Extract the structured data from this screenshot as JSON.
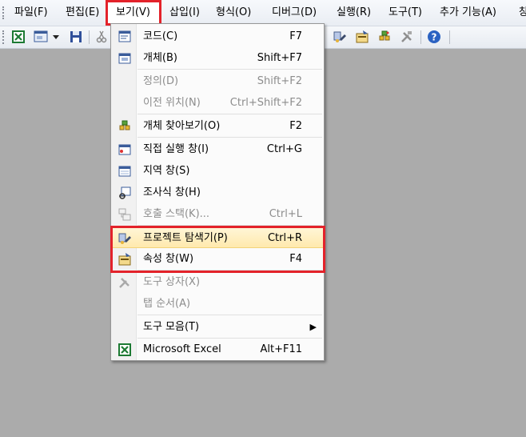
{
  "menubar": {
    "items": [
      {
        "label": "파일(F)"
      },
      {
        "label": "편집(E)"
      },
      {
        "label": "보기(V)"
      },
      {
        "label": "삽입(I)"
      },
      {
        "label": "형식(O)"
      },
      {
        "label": "디버그(D)"
      },
      {
        "label": "실행(R)"
      },
      {
        "label": "도구(T)"
      },
      {
        "label": "추가 기능(A)"
      },
      {
        "label": "창"
      }
    ]
  },
  "view_menu": {
    "items": [
      {
        "label": "코드(C)",
        "shortcut": "F7",
        "enabled": true,
        "icon": "code-window-icon"
      },
      {
        "label": "개체(B)",
        "shortcut": "Shift+F7",
        "enabled": true,
        "icon": "object-window-icon"
      },
      {
        "label": "정의(D)",
        "shortcut": "Shift+F2",
        "enabled": false,
        "icon": ""
      },
      {
        "label": "이전 위치(N)",
        "shortcut": "Ctrl+Shift+F2",
        "enabled": false,
        "icon": ""
      },
      {
        "label": "개체 찾아보기(O)",
        "shortcut": "F2",
        "enabled": true,
        "icon": "object-browser-icon"
      },
      {
        "label": "직접 실행 창(I)",
        "shortcut": "Ctrl+G",
        "enabled": true,
        "icon": "immediate-window-icon"
      },
      {
        "label": "지역 창(S)",
        "shortcut": "",
        "enabled": true,
        "icon": "locals-window-icon"
      },
      {
        "label": "조사식 창(H)",
        "shortcut": "",
        "enabled": true,
        "icon": "watch-window-icon"
      },
      {
        "label": "호출 스택(K)...",
        "shortcut": "Ctrl+L",
        "enabled": false,
        "icon": "call-stack-icon"
      },
      {
        "label": "프로젝트 탐색기(P)",
        "shortcut": "Ctrl+R",
        "enabled": true,
        "icon": "project-explorer-icon"
      },
      {
        "label": "속성 창(W)",
        "shortcut": "F4",
        "enabled": true,
        "icon": "properties-window-icon"
      },
      {
        "label": "도구 상자(X)",
        "shortcut": "",
        "enabled": false,
        "icon": "toolbox-icon"
      },
      {
        "label": "탭 순서(A)",
        "shortcut": "",
        "enabled": false,
        "icon": ""
      },
      {
        "label": "도구 모음(T)",
        "shortcut": "",
        "enabled": true,
        "icon": "",
        "submenu_arrow": "▶"
      },
      {
        "label": "Microsoft Excel",
        "shortcut": "Alt+F11",
        "enabled": true,
        "icon": "excel-icon"
      }
    ]
  },
  "colors": {
    "highlight_border": "#e3222a",
    "disabled_text": "#8d8d8d",
    "hover_background": "#ffe9ad"
  }
}
